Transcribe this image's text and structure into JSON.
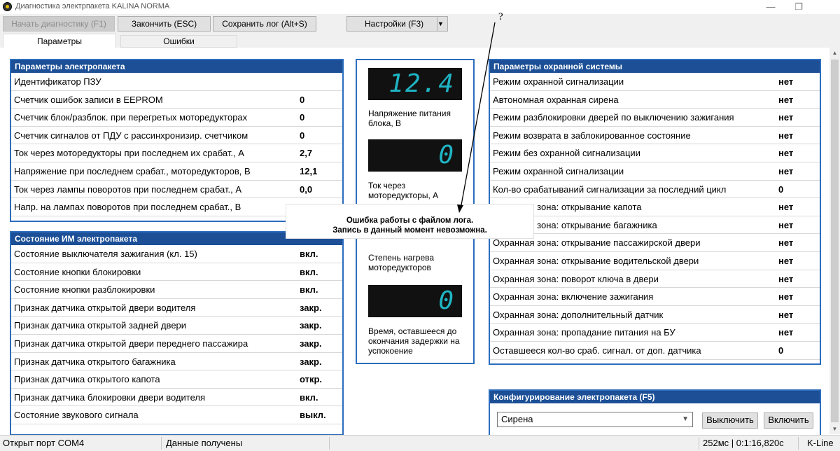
{
  "window": {
    "title": "Диагностика электрпакета KALINA NORMA",
    "minimize": "—",
    "restore": "❐"
  },
  "toolbar": {
    "start": "Начать диагностику (F1)",
    "finish": "Закончить (ESC)",
    "save_log": "Сохранить лог (Alt+S)",
    "settings": "Настройки (F3)"
  },
  "tabs": {
    "params": "Параметры",
    "errors": "Ошибки"
  },
  "electro_params": {
    "title": "Параметры электропакета",
    "rows": [
      {
        "label": "Идентификатор ПЗУ",
        "value": ""
      },
      {
        "label": "Счетчик ошибок записи в EEPROM",
        "value": "0"
      },
      {
        "label": "Счетчик блок/разблок. при перегретых моторедукторах",
        "value": "0"
      },
      {
        "label": "Счетчик сигналов от ПДУ с рассинхронизир. счетчиком",
        "value": "0"
      },
      {
        "label": "Ток через моторедукторы при последнем их срабат., А",
        "value": "2,7"
      },
      {
        "label": "Напряжение при последнем срабат., моторедукторов, В",
        "value": "12,1"
      },
      {
        "label": "Ток через лампы поворотов при последнем срабат., А",
        "value": "0,0"
      },
      {
        "label": "Напр. на лампах поворотов при последнем срабат., В",
        "value": ""
      }
    ]
  },
  "im_state": {
    "title": "Состояние ИМ электропакета",
    "rows": [
      {
        "label": "Состояние выключателя зажигания (кл. 15)",
        "value": "вкл."
      },
      {
        "label": "Состояние кнопки блокировки",
        "value": "вкл."
      },
      {
        "label": "Состояние кнопки разблокировки",
        "value": "вкл."
      },
      {
        "label": "Признак датчика открытой двери водителя",
        "value": "закр."
      },
      {
        "label": "Признак датчика открытой задней двери",
        "value": "закр."
      },
      {
        "label": "Признак датчика открытой двери переднего пассажира",
        "value": "закр."
      },
      {
        "label": "Признак датчика открытого багажника",
        "value": "закр."
      },
      {
        "label": "Признак датчика открытого капота",
        "value": "откр."
      },
      {
        "label": "Признак датчика блокировки двери водителя",
        "value": "вкл."
      },
      {
        "label": "Состояние звукового сигнала",
        "value": "выкл."
      }
    ]
  },
  "gauges": [
    {
      "value": "12.4",
      "label": "Напряжение питания блока, В"
    },
    {
      "value": "0",
      "label": "Ток через моторедукторы, А"
    },
    {
      "label": "Степень нагрева моторедукторов"
    },
    {
      "value": "0",
      "label": "Время, оставшееся до окончания задержки на успокоение"
    }
  ],
  "security": {
    "title": "Параметры охранной системы",
    "rows": [
      {
        "label": "Режим охранной сигнализации",
        "value": "нет"
      },
      {
        "label": "Автономная охранная сирена",
        "value": "нет"
      },
      {
        "label": "Режим разблокировки дверей по выключению зажигания",
        "value": "нет"
      },
      {
        "label": "Режим возврата в заблокированное состояние",
        "value": "нет"
      },
      {
        "label": "Режим без охранной сигнализации",
        "value": "нет"
      },
      {
        "label": "Режим охранной сигнализации",
        "value": "нет"
      },
      {
        "label": "Кол-во срабатываний сигнализации за последний цикл",
        "value": "0"
      },
      {
        "label": "Охранная зона: открывание капота",
        "value": "нет"
      },
      {
        "label": "Охранная зона: открывание багажника",
        "value": "нет"
      },
      {
        "label": "Охранная зона: открывание пассажирской двери",
        "value": "нет"
      },
      {
        "label": "Охранная зона: открывание водительской двери",
        "value": "нет"
      },
      {
        "label": "Охранная зона: поворот ключа в двери",
        "value": "нет"
      },
      {
        "label": "Охранная зона: включение зажигания",
        "value": "нет"
      },
      {
        "label": "Охранная зона: дополнительный датчик",
        "value": "нет"
      },
      {
        "label": "Охранная зона: пропадание питания на БУ",
        "value": "нет"
      },
      {
        "label": "Оставшееся кол-во сраб. сигнал. от доп. датчика",
        "value": "0"
      }
    ]
  },
  "config": {
    "title": "Конфигурирование электропакета (F5)",
    "selected": "Сирена",
    "off": "Выключить",
    "on": "Включить"
  },
  "message": {
    "line1": "Ошибка работы с файлом лога.",
    "line2": "Запись в данный момент невозможна."
  },
  "annotation": "?",
  "status": {
    "port": "Открыт порт COM4",
    "data": "Данные получены",
    "timing": "252мс | 0:1:16,820с",
    "line": "K-Line"
  },
  "colors": {
    "header_bg": "#1c4f96",
    "panel_border": "#2c6dbd",
    "lcd_digit": "#1fb4c4"
  }
}
